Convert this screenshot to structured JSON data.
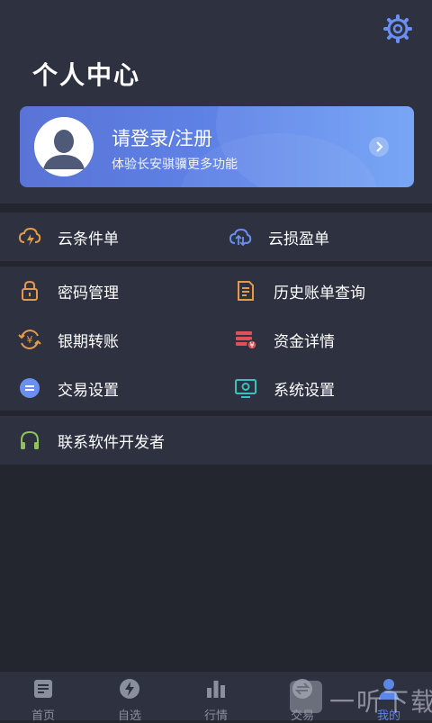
{
  "page": {
    "title": "个人中心"
  },
  "login": {
    "title": "请登录/注册",
    "subtitle": "体验长安骐骥更多功能"
  },
  "menu": {
    "cloud": [
      {
        "label": "云条件单",
        "icon": "cloud-lightning-icon"
      },
      {
        "label": "云损盈单",
        "icon": "cloud-arrows-icon"
      }
    ],
    "tools": [
      {
        "label": "密码管理",
        "icon": "lock-icon"
      },
      {
        "label": "历史账单查询",
        "icon": "bill-icon"
      },
      {
        "label": "银期转账",
        "icon": "yuan-exchange-icon"
      },
      {
        "label": "资金详情",
        "icon": "funds-icon"
      },
      {
        "label": "交易设置",
        "icon": "trade-settings-icon"
      },
      {
        "label": "系统设置",
        "icon": "system-settings-icon"
      }
    ],
    "contact": {
      "label": "联系软件开发者",
      "icon": "headphones-icon"
    }
  },
  "tabbar": [
    {
      "label": "首页",
      "icon": "home-icon"
    },
    {
      "label": "自选",
      "icon": "lightning-icon"
    },
    {
      "label": "行情",
      "icon": "bar-chart-icon"
    },
    {
      "label": "交易",
      "icon": "trade-icon"
    },
    {
      "label": "我的",
      "icon": "user-icon"
    }
  ],
  "active_tab": "我的",
  "watermark": {
    "text": "一听下载"
  },
  "colors": {
    "background": "#23252f",
    "panel": "#2d3140",
    "accent": "#5d86e6",
    "icon_orange": "#e39b4a",
    "icon_blue": "#6b8ff0",
    "icon_red": "#e0505a",
    "icon_teal": "#36c3c0",
    "icon_green": "#8fc25a"
  }
}
